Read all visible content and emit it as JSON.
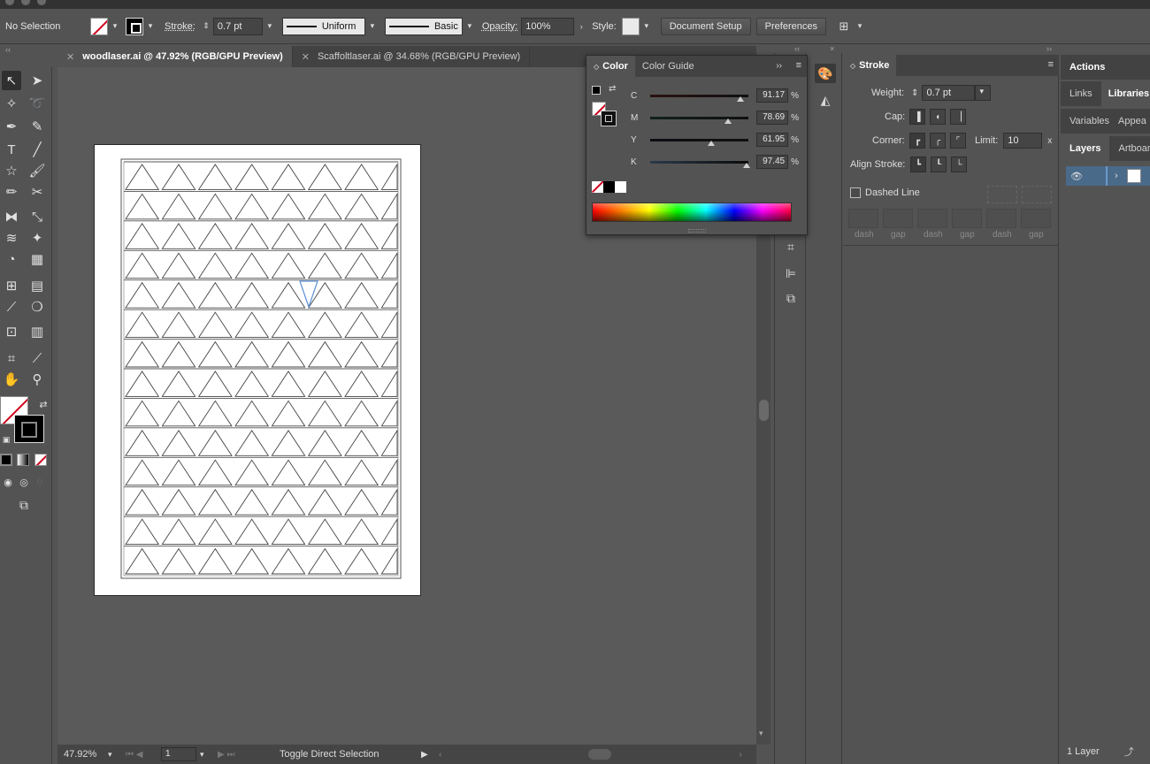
{
  "control_bar": {
    "selection_status": "No Selection",
    "stroke_label": "Stroke:",
    "stroke_weight": "0.7 pt",
    "stroke_profile": "Uniform",
    "brush": "Basic",
    "opacity_label": "Opacity:",
    "opacity_value": "100%",
    "style_label": "Style:",
    "document_setup": "Document Setup",
    "preferences": "Preferences"
  },
  "tabs": [
    {
      "label": "woodlaser.ai @ 47.92% (RGB/GPU Preview)",
      "active": true
    },
    {
      "label": "Scaffoltlaser.ai @ 34.68% (RGB/GPU Preview)",
      "active": false
    }
  ],
  "status_bar": {
    "zoom": "47.92%",
    "artboard_number": "1",
    "current_tool": "Toggle Direct Selection"
  },
  "color_panel": {
    "tabs": [
      "Color",
      "Color Guide"
    ],
    "sliders": [
      {
        "label": "C",
        "value": "91.17",
        "unit": "%",
        "fraction": 0.9117
      },
      {
        "label": "M",
        "value": "78.69",
        "unit": "%",
        "fraction": 0.7869
      },
      {
        "label": "Y",
        "value": "61.95",
        "unit": "%",
        "fraction": 0.6195
      },
      {
        "label": "K",
        "value": "97.45",
        "unit": "%",
        "fraction": 0.9745
      }
    ]
  },
  "stroke_panel": {
    "title": "Stroke",
    "weight_label": "Weight:",
    "weight_value": "0.7 pt",
    "cap_label": "Cap:",
    "corner_label": "Corner:",
    "limit_label": "Limit:",
    "limit_value": "10",
    "align_label": "Align Stroke:",
    "dashed_line_label": "Dashed Line",
    "dash_labels": [
      "dash",
      "gap",
      "dash",
      "gap",
      "dash",
      "gap"
    ]
  },
  "right_panels": {
    "actions": "Actions",
    "links": "Links",
    "libraries": "Libraries",
    "variables": "Variables",
    "appearance": "Appea",
    "layers": "Layers",
    "artboards": "Artboar",
    "layer_count": "1 Layer"
  },
  "colors": {
    "ui_bg": "#535353",
    "panel_dark": "#424242",
    "accent_red": "#d0021b",
    "layer_row": "#4a6a8a"
  }
}
